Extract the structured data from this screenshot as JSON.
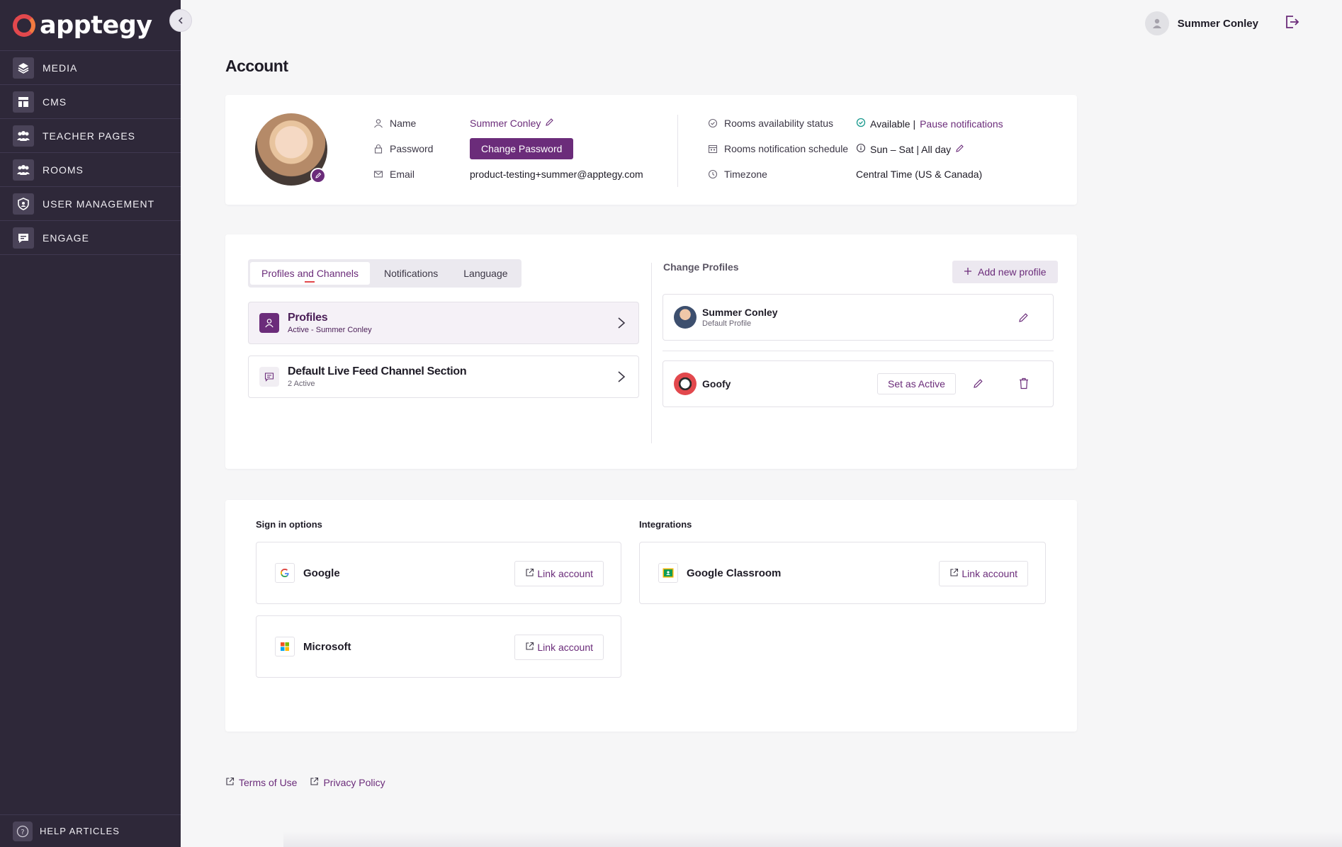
{
  "app": {
    "name": "apptegy"
  },
  "sidebar": {
    "items": [
      {
        "label": "MEDIA",
        "icon": "layers-icon"
      },
      {
        "label": "CMS",
        "icon": "layout-icon"
      },
      {
        "label": "TEACHER PAGES",
        "icon": "users-icon"
      },
      {
        "label": "ROOMS",
        "icon": "users-icon"
      },
      {
        "label": "USER MANAGEMENT",
        "icon": "shield-icon"
      },
      {
        "label": "ENGAGE",
        "icon": "chat-icon"
      }
    ],
    "help_label": "HELP ARTICLES"
  },
  "header": {
    "user_name": "Summer Conley"
  },
  "page": {
    "title": "Account"
  },
  "account": {
    "name_label": "Name",
    "name_value": "Summer Conley",
    "password_label": "Password",
    "change_password_label": "Change Password",
    "email_label": "Email",
    "email_value": "product-testing+summer@apptegy.com",
    "availability_label": "Rooms availability status",
    "availability_value": "Available |",
    "pause_label": "Pause notifications",
    "schedule_label": "Rooms notification schedule",
    "schedule_value": "Sun – Sat | All day",
    "timezone_label": "Timezone",
    "timezone_value": "Central Time (US & Canada)"
  },
  "tabs": [
    {
      "label": "Profiles and Channels",
      "active": true
    },
    {
      "label": "Notifications",
      "active": false
    },
    {
      "label": "Language",
      "active": false
    }
  ],
  "sections": [
    {
      "title": "Profiles",
      "subtitle": "Active - Summer Conley"
    },
    {
      "title": "Default Live Feed Channel Section",
      "subtitle": "2 Active"
    }
  ],
  "change_profiles": {
    "title": "Change Profiles",
    "add_label": "Add new profile",
    "profiles": [
      {
        "name": "Summer Conley",
        "subtitle": "Default Profile"
      },
      {
        "name": "Goofy",
        "set_active_label": "Set as Active"
      }
    ]
  },
  "signin": {
    "title": "Sign in options",
    "options": [
      {
        "name": "Google",
        "link_label": "Link account"
      },
      {
        "name": "Microsoft",
        "link_label": "Link account"
      }
    ]
  },
  "integrations": {
    "title": "Integrations",
    "options": [
      {
        "name": "Google Classroom",
        "link_label": "Link account"
      }
    ]
  },
  "footer": {
    "terms": "Terms of Use",
    "privacy": "Privacy Policy"
  },
  "colors": {
    "sidebar": "#2e2839",
    "accent": "#6b2c7a",
    "brand_red": "#e2484d"
  }
}
